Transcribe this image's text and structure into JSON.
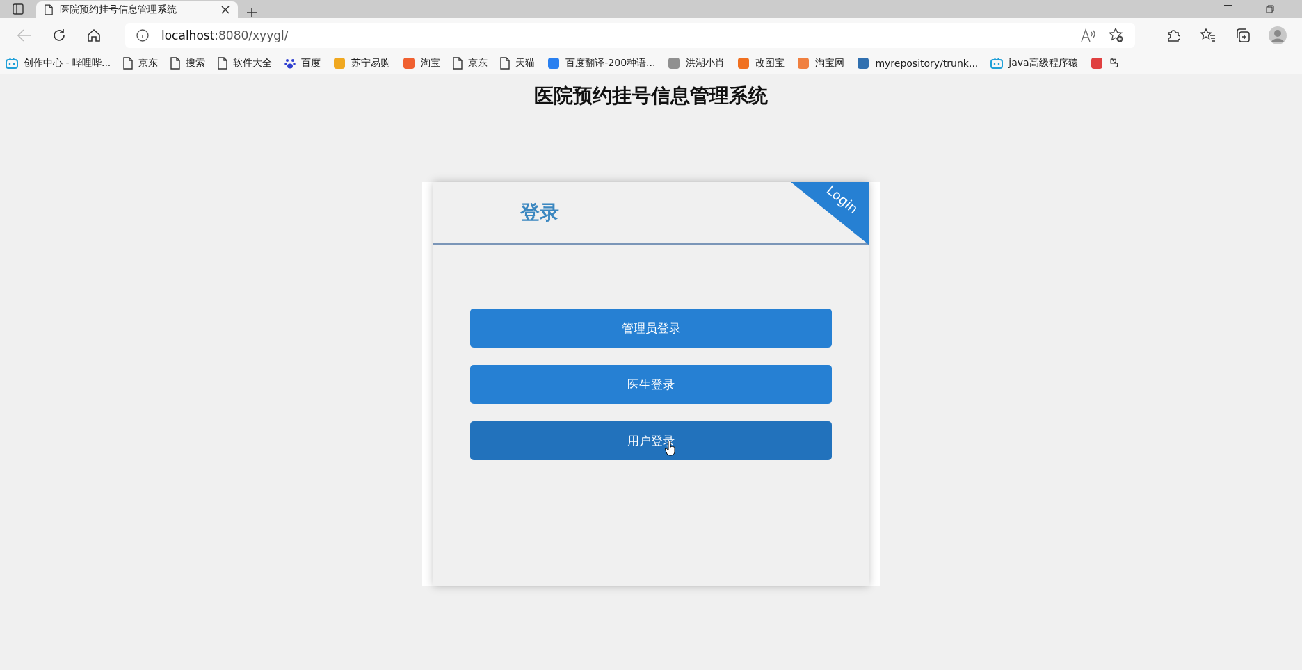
{
  "browser": {
    "tab": {
      "title": "医院预约挂号信息管理系统"
    },
    "address": {
      "host": "localhost",
      "rest": ":8080/xyygl/"
    },
    "bookmarks": [
      {
        "label": "创作中心 - 哔哩哔...",
        "kind": "tv",
        "color": "#20a0d8"
      },
      {
        "label": "京东",
        "kind": "page"
      },
      {
        "label": "搜索",
        "kind": "page"
      },
      {
        "label": "软件大全",
        "kind": "page"
      },
      {
        "label": "百度",
        "kind": "paw",
        "color": "#3040d0"
      },
      {
        "label": "苏宁易购",
        "kind": "site",
        "color": "#f0a820"
      },
      {
        "label": "淘宝",
        "kind": "site",
        "color": "#f06030"
      },
      {
        "label": "京东",
        "kind": "page"
      },
      {
        "label": "天猫",
        "kind": "page"
      },
      {
        "label": "百度翻译-200种语...",
        "kind": "site",
        "color": "#2a80f0"
      },
      {
        "label": "洪湖小肖",
        "kind": "site",
        "color": "#909090"
      },
      {
        "label": "改图宝",
        "kind": "site",
        "color": "#f07020"
      },
      {
        "label": "淘宝网",
        "kind": "site",
        "color": "#f08040"
      },
      {
        "label": "myrepository/trunk...",
        "kind": "site",
        "color": "#3070b0"
      },
      {
        "label": "java高级程序猿",
        "kind": "tv",
        "color": "#20a0d8"
      },
      {
        "label": "鸟",
        "kind": "site",
        "color": "#e04040"
      }
    ]
  },
  "page": {
    "title": "医院预约挂号信息管理系统",
    "card": {
      "heading": "登录",
      "ribbon": "Login",
      "buttons": [
        {
          "label": "管理员登录",
          "hovered": false
        },
        {
          "label": "医生登录",
          "hovered": false
        },
        {
          "label": "用户登录",
          "hovered": true
        }
      ]
    }
  }
}
